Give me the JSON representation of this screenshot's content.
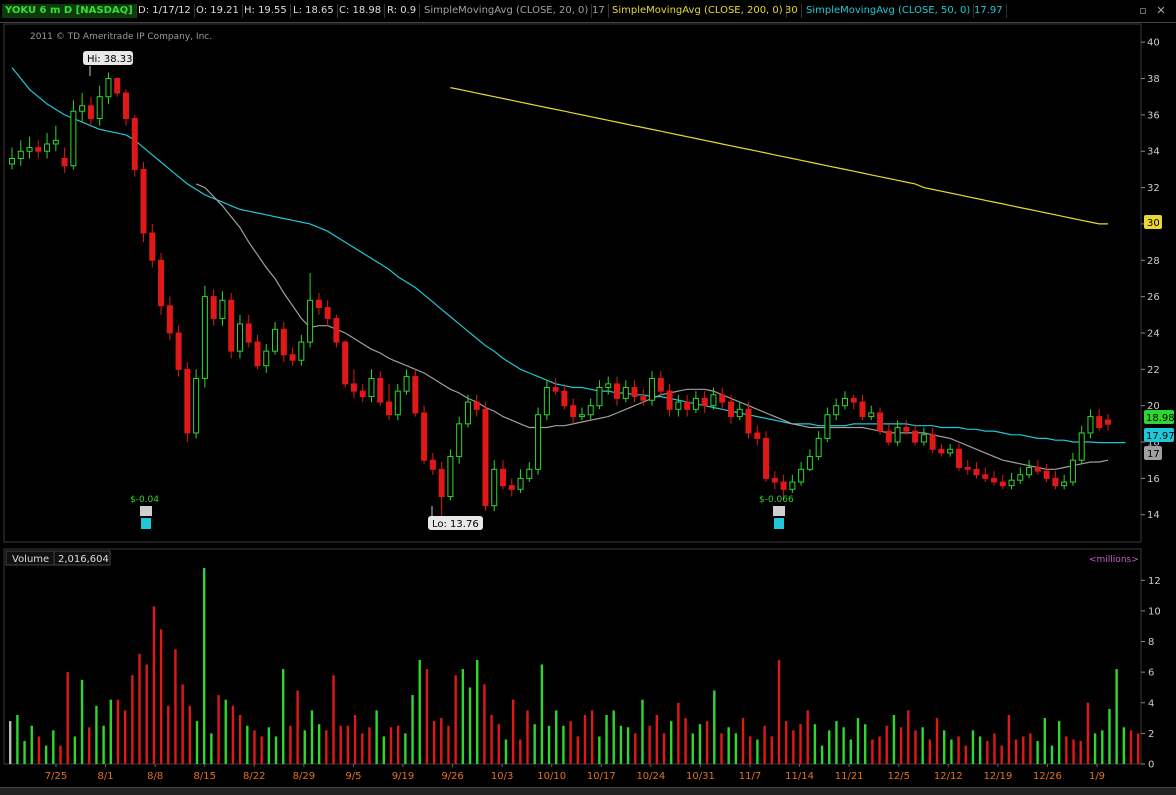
{
  "header": {
    "ticker": "YOKU 6 m D [NASDAQ]",
    "date": "D: 1/17/12",
    "open": "O: 19.21",
    "high": "H: 19.55",
    "low": "L: 18.65",
    "close": "C: 18.98",
    "range": "R: 0.9",
    "sma20_label": "SimpleMovingAvg (CLOSE, 20, 0)",
    "sma20_value": "17",
    "sma200_label": "SimpleMovingAvg (CLOSE, 200, 0)",
    "sma200_value": "30",
    "sma50_label": "SimpleMovingAvg (CLOSE, 50, 0)",
    "sma50_value": "17.97"
  },
  "copyright": "2011 © TD Ameritrade IP Company, Inc.",
  "colors": {
    "up": "#2fd62f",
    "down": "#e01818",
    "sma20": "#a0a0a0",
    "sma50": "#1ec8d8",
    "sma200": "#e8d830"
  },
  "annotations": {
    "hi": "Hi: 38.33",
    "lo": "Lo: 13.76",
    "div1": "$-0.04",
    "div2": "$-0.066",
    "price_last": "18.98",
    "price_sma50": "17.97",
    "price_sma20": "17",
    "price_sma200": "30"
  },
  "volume_panel": {
    "label": "Volume",
    "value": "2,016,604",
    "unit": "<millions>"
  },
  "chart_data": [
    {
      "type": "candlestick",
      "ylim": [
        12.5,
        41
      ],
      "y_ticks": [
        "14",
        "16",
        "18",
        "20",
        "22",
        "24",
        "26",
        "28",
        "30",
        "32",
        "34",
        "36",
        "38",
        "40"
      ],
      "x_ticks": [
        "7/25",
        "8/1",
        "8/8",
        "8/15",
        "8/22",
        "8/29",
        "9/5",
        "9/19",
        "9/26",
        "10/3",
        "10/10",
        "10/17",
        "10/24",
        "10/31",
        "11/7",
        "11/14",
        "11/21",
        "12/5",
        "12/12",
        "12/19",
        "12/26",
        "1/9"
      ],
      "grid": false,
      "close": [
        33.6,
        34.0,
        34.2,
        34.0,
        34.4,
        34.6,
        33.2,
        36.2,
        36.5,
        35.8,
        37.0,
        38.0,
        37.2,
        35.8,
        33.0,
        29.5,
        28.0,
        25.5,
        24.0,
        22.0,
        18.5,
        21.5,
        26.0,
        24.8,
        25.8,
        23.0,
        24.5,
        23.5,
        22.2,
        23.0,
        24.2,
        22.8,
        22.5,
        23.5,
        25.8,
        25.4,
        24.8,
        23.5,
        21.2,
        20.8,
        20.5,
        21.5,
        20.2,
        19.5,
        20.8,
        21.6,
        19.6,
        17.0,
        16.5,
        15.0,
        17.2,
        19.0,
        20.2,
        19.8,
        14.5,
        16.5,
        15.6,
        15.4,
        16.0,
        16.5,
        19.5,
        21.0,
        20.8,
        20.0,
        19.4,
        19.5,
        20.0,
        21.0,
        21.2,
        20.4,
        21.0,
        20.5,
        20.3,
        21.5,
        20.8,
        19.8,
        20.2,
        19.8,
        20.4,
        20.0,
        20.6,
        20.2,
        19.4,
        19.8,
        18.5,
        18.2,
        16.0,
        15.8,
        15.4,
        15.8,
        16.5,
        17.2,
        18.2,
        19.5,
        20.0,
        20.4,
        20.2,
        19.4,
        19.6,
        18.6,
        18.0,
        18.8,
        18.6,
        18.0,
        18.4,
        17.6,
        17.4,
        17.6,
        16.6,
        16.5,
        16.2,
        16.0,
        15.8,
        15.6,
        15.9,
        16.2,
        16.6,
        16.4,
        16.0,
        15.6,
        15.8,
        17.0,
        18.5,
        19.4,
        18.8,
        18.98
      ],
      "open": [
        33.3,
        33.6,
        34.0,
        34.2,
        34.0,
        34.4,
        33.6,
        33.2,
        36.2,
        36.5,
        35.8,
        37.0,
        38.0,
        37.2,
        35.8,
        33.0,
        29.5,
        28.0,
        25.5,
        24.0,
        22.0,
        18.5,
        21.5,
        26.0,
        24.8,
        25.8,
        23.0,
        24.5,
        23.5,
        22.2,
        23.0,
        24.2,
        22.8,
        22.5,
        23.5,
        25.8,
        25.4,
        24.8,
        23.5,
        21.2,
        20.8,
        20.5,
        21.5,
        20.2,
        19.5,
        20.8,
        21.6,
        19.6,
        17.0,
        16.5,
        15.0,
        17.2,
        19.0,
        20.2,
        19.8,
        14.5,
        16.5,
        15.6,
        15.4,
        16.0,
        16.5,
        19.5,
        21.0,
        20.8,
        20.0,
        19.4,
        19.5,
        20.0,
        21.0,
        21.2,
        20.4,
        21.0,
        20.5,
        20.3,
        21.5,
        20.8,
        19.8,
        20.2,
        19.8,
        20.4,
        20.0,
        20.6,
        20.2,
        19.4,
        19.8,
        18.5,
        18.2,
        16.0,
        15.8,
        15.4,
        15.8,
        16.5,
        17.2,
        18.2,
        19.5,
        20.0,
        20.4,
        20.2,
        19.4,
        19.6,
        18.6,
        18.0,
        18.8,
        18.6,
        18.0,
        18.4,
        17.6,
        17.4,
        17.6,
        16.6,
        16.5,
        16.2,
        16.0,
        15.8,
        15.6,
        15.9,
        16.2,
        16.6,
        16.4,
        16.0,
        15.6,
        15.8,
        17.0,
        18.5,
        19.4,
        19.21
      ],
      "high": [
        34.2,
        34.6,
        34.8,
        34.6,
        35.0,
        35.4,
        34.2,
        36.8,
        37.2,
        37.0,
        37.6,
        38.33,
        38.0,
        37.4,
        36.0,
        33.4,
        30.0,
        28.4,
        26.0,
        24.4,
        22.4,
        22.0,
        26.6,
        26.4,
        26.3,
        26.2,
        25.0,
        25.0,
        23.9,
        23.4,
        24.6,
        24.6,
        23.2,
        23.9,
        27.3,
        26.2,
        25.8,
        25.0,
        23.6,
        22.0,
        21.2,
        22.0,
        21.9,
        21.2,
        21.2,
        22.0,
        22.0,
        20.0,
        17.4,
        16.9,
        17.6,
        19.4,
        20.6,
        20.6,
        20.2,
        17.0,
        17.0,
        16.0,
        16.5,
        16.9,
        19.9,
        21.4,
        21.5,
        21.2,
        20.4,
        19.9,
        20.4,
        21.4,
        21.6,
        21.6,
        21.4,
        21.4,
        20.9,
        21.9,
        21.9,
        21.2,
        20.6,
        20.6,
        20.8,
        20.8,
        21.0,
        21.0,
        20.6,
        20.2,
        20.2,
        18.9,
        18.6,
        16.4,
        16.2,
        16.2,
        16.9,
        17.6,
        18.6,
        19.9,
        20.4,
        20.8,
        20.6,
        20.6,
        20.0,
        19.9,
        19.0,
        19.2,
        19.2,
        19.0,
        18.8,
        18.8,
        17.9,
        17.9,
        17.9,
        17.0,
        16.9,
        16.6,
        16.4,
        16.2,
        16.3,
        16.6,
        17.0,
        17.0,
        16.8,
        16.4,
        16.2,
        17.4,
        18.9,
        19.8,
        19.8,
        19.55
      ],
      "low": [
        33.0,
        33.2,
        33.6,
        33.6,
        33.6,
        34.0,
        32.8,
        33.0,
        35.6,
        35.4,
        35.4,
        36.6,
        37.0,
        35.4,
        32.6,
        29.0,
        27.6,
        25.0,
        23.6,
        21.6,
        18.0,
        18.2,
        21.0,
        24.4,
        24.4,
        22.6,
        22.6,
        23.2,
        22.0,
        21.8,
        22.8,
        22.4,
        22.2,
        22.2,
        23.2,
        25.0,
        24.4,
        23.2,
        21.0,
        20.4,
        20.2,
        20.2,
        20.0,
        19.2,
        19.2,
        20.6,
        19.4,
        16.8,
        16.2,
        13.76,
        14.8,
        16.8,
        18.8,
        19.4,
        14.2,
        14.2,
        15.4,
        15.0,
        15.2,
        15.8,
        16.2,
        19.2,
        20.6,
        19.8,
        19.0,
        19.2,
        19.2,
        19.8,
        20.6,
        20.0,
        20.2,
        20.2,
        20.0,
        20.0,
        20.6,
        19.4,
        19.4,
        19.4,
        19.6,
        19.6,
        19.8,
        19.8,
        19.0,
        19.2,
        18.2,
        17.8,
        15.8,
        15.4,
        15.0,
        15.2,
        15.6,
        16.4,
        17.0,
        18.0,
        19.2,
        19.8,
        19.8,
        19.2,
        19.2,
        18.4,
        17.8,
        17.8,
        18.4,
        17.8,
        17.8,
        17.4,
        17.2,
        17.2,
        16.4,
        16.2,
        16.0,
        15.8,
        15.6,
        15.4,
        15.4,
        15.7,
        16.0,
        16.2,
        15.8,
        15.4,
        15.4,
        15.6,
        16.8,
        18.2,
        18.6,
        18.65
      ],
      "sma20": [
        null,
        null,
        null,
        null,
        null,
        null,
        null,
        null,
        null,
        null,
        null,
        null,
        null,
        null,
        null,
        null,
        null,
        null,
        null,
        null,
        null,
        32.2,
        32.0,
        31.5,
        31.0,
        30.4,
        29.8,
        29.0,
        28.3,
        27.6,
        27.0,
        26.2,
        25.5,
        24.8,
        24.3,
        24.4,
        24.4,
        24.2,
        24.0,
        23.7,
        23.4,
        23.1,
        22.9,
        22.6,
        22.4,
        22.2,
        22.0,
        21.8,
        21.5,
        21.2,
        20.9,
        20.7,
        20.4,
        20.2,
        19.9,
        19.7,
        19.4,
        19.2,
        19.0,
        18.8,
        18.8,
        18.8,
        18.9,
        18.9,
        19.0,
        19.1,
        19.2,
        19.3,
        19.4,
        19.6,
        19.8,
        20.0,
        20.2,
        20.4,
        20.6,
        20.7,
        20.8,
        20.9,
        20.9,
        20.9,
        20.8,
        20.6,
        20.4,
        20.2,
        20.0,
        19.8,
        19.6,
        19.4,
        19.2,
        19.0,
        18.9,
        18.8,
        18.8,
        18.8,
        18.8,
        18.8,
        18.8,
        18.8,
        18.7,
        18.6,
        18.5,
        18.5,
        18.5,
        18.5,
        18.5,
        18.4,
        18.3,
        18.2,
        18.0,
        17.8,
        17.6,
        17.4,
        17.2,
        17.0,
        16.9,
        16.8,
        16.7,
        16.6,
        16.5,
        16.5,
        16.6,
        16.7,
        16.8,
        16.9,
        16.9,
        17.0
      ],
      "sma50": [
        38.6,
        38.0,
        37.4,
        37.0,
        36.6,
        36.3,
        36.0,
        35.8,
        35.6,
        35.4,
        35.2,
        35.1,
        35.0,
        34.9,
        34.6,
        34.2,
        33.8,
        33.4,
        33.0,
        32.6,
        32.2,
        31.9,
        31.6,
        31.4,
        31.2,
        31.0,
        30.8,
        30.7,
        30.6,
        30.5,
        30.4,
        30.3,
        30.2,
        30.1,
        30.0,
        29.8,
        29.6,
        29.3,
        29.0,
        28.7,
        28.4,
        28.1,
        27.8,
        27.5,
        27.1,
        26.8,
        26.5,
        26.1,
        25.7,
        25.3,
        24.9,
        24.5,
        24.1,
        23.7,
        23.3,
        23.0,
        22.6,
        22.3,
        22.0,
        21.8,
        21.6,
        21.4,
        21.2,
        21.1,
        21.0,
        21.0,
        20.9,
        20.8,
        20.8,
        20.7,
        20.7,
        20.6,
        20.6,
        20.5,
        20.5,
        20.4,
        20.3,
        20.2,
        20.1,
        20.0,
        19.9,
        19.8,
        19.7,
        19.6,
        19.5,
        19.4,
        19.3,
        19.2,
        19.1,
        19.0,
        19.0,
        19.0,
        18.9,
        18.9,
        18.9,
        18.9,
        19.0,
        19.0,
        19.0,
        19.0,
        19.0,
        19.0,
        19.0,
        18.9,
        18.9,
        18.9,
        18.8,
        18.8,
        18.8,
        18.7,
        18.7,
        18.6,
        18.6,
        18.5,
        18.4,
        18.4,
        18.3,
        18.2,
        18.2,
        18.1,
        18.1,
        18.0,
        18.0,
        18.0,
        17.97,
        17.97,
        17.97,
        17.97
      ],
      "sma200": [
        null,
        null,
        null,
        null,
        null,
        null,
        null,
        null,
        null,
        null,
        null,
        null,
        null,
        null,
        null,
        null,
        null,
        null,
        null,
        null,
        null,
        null,
        null,
        null,
        null,
        null,
        null,
        null,
        null,
        null,
        null,
        null,
        null,
        null,
        null,
        null,
        null,
        null,
        null,
        null,
        null,
        null,
        null,
        null,
        null,
        null,
        null,
        null,
        null,
        null,
        37.5,
        37.4,
        37.3,
        37.2,
        37.1,
        37.0,
        36.9,
        36.8,
        36.7,
        36.6,
        36.5,
        36.4,
        36.3,
        36.2,
        36.1,
        36.0,
        35.9,
        35.8,
        35.7,
        35.6,
        35.5,
        35.4,
        35.3,
        35.2,
        35.1,
        35.0,
        34.9,
        34.8,
        34.7,
        34.6,
        34.5,
        34.4,
        34.3,
        34.2,
        34.1,
        34.0,
        33.9,
        33.8,
        33.7,
        33.6,
        33.5,
        33.4,
        33.3,
        33.2,
        33.1,
        33.0,
        32.9,
        32.8,
        32.7,
        32.6,
        32.5,
        32.4,
        32.3,
        32.2,
        32.0,
        31.9,
        31.8,
        31.7,
        31.6,
        31.5,
        31.4,
        31.3,
        31.2,
        31.1,
        31.0,
        30.9,
        30.8,
        30.7,
        30.6,
        30.5,
        30.4,
        30.3,
        30.2,
        30.1,
        30.0,
        30.0
      ]
    },
    {
      "type": "bar",
      "ylim": [
        0,
        13
      ],
      "y_ticks": [
        "0",
        "2",
        "4",
        "6",
        "8",
        "10",
        "12"
      ],
      "values": [
        2.8,
        3.2,
        1.5,
        2.5,
        1.8,
        1.2,
        2.2,
        1.2,
        6.0,
        1.8,
        5.5,
        2.4,
        3.8,
        2.5,
        4.2,
        4.2,
        3.5,
        5.8,
        7.2,
        6.5,
        10.3,
        8.8,
        3.8,
        7.5,
        5.2,
        3.8,
        2.8,
        12.8,
        2.0,
        4.5,
        4.2,
        3.8,
        3.2,
        2.5,
        2.2,
        1.8,
        2.4,
        1.8,
        6.2,
        2.5,
        4.8,
        2.2,
        3.5,
        2.6,
        2.2,
        5.8,
        2.5,
        2.5,
        3.2,
        2.0,
        2.4,
        3.5,
        1.8,
        2.4,
        2.5,
        2.0,
        4.5,
        6.8,
        6.2,
        2.8,
        3.0,
        2.5,
        5.8,
        6.2,
        5.0,
        6.8,
        5.2,
        3.2,
        2.6,
        1.6,
        4.2,
        1.6,
        3.5,
        2.6,
        6.5,
        2.5,
        3.5,
        2.5,
        2.8,
        1.8,
        3.2,
        3.5,
        1.8,
        3.2,
        3.5,
        2.5,
        2.4,
        2.0,
        4.2,
        2.5,
        3.2,
        2.0,
        2.8,
        4.0,
        3.0,
        2.0,
        2.6,
        2.8,
        4.8,
        2.0,
        2.4,
        2.0,
        3.0,
        1.8,
        1.6,
        2.5,
        1.8,
        6.8,
        2.8,
        2.2,
        2.6,
        3.5,
        2.6,
        1.2,
        2.2,
        2.8,
        2.4,
        1.6,
        3.0,
        2.6,
        1.6,
        1.8,
        2.5,
        3.2,
        2.4,
        3.5,
        2.2,
        2.4,
        1.6,
        3.0,
        2.2,
        1.6,
        1.8,
        1.2,
        2.2,
        1.8,
        1.5,
        2.0,
        1.2,
        3.2,
        1.6,
        1.8,
        2.0,
        1.5,
        3.0,
        1.2,
        2.8,
        1.8,
        1.6,
        1.5,
        4.0,
        2.0,
        2.2,
        3.6,
        6.2,
        2.4,
        2.2,
        2.0
      ]
    }
  ]
}
